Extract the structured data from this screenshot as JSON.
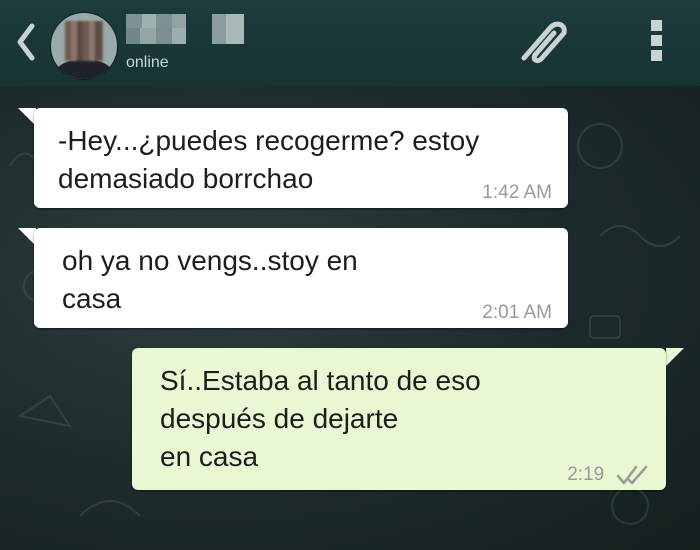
{
  "header": {
    "status": "online"
  },
  "messages": [
    {
      "direction": "incoming",
      "lines": [
        "-Hey...¿puedes recogerme? estoy",
        "demasiado borrchao"
      ],
      "time": "1:42 AM"
    },
    {
      "direction": "incoming",
      "lines": [
        "oh ya no vengs..stoy en",
        "casa"
      ],
      "time": "2:01 AM"
    },
    {
      "direction": "outgoing",
      "lines": [
        "Sí..Estaba al tanto de eso",
        "después de dejarte",
        "en casa"
      ],
      "time": "2:19",
      "receipt": "double-check-icon"
    }
  ],
  "icons": {
    "back": "chevron-left-icon",
    "attach": "paperclip-icon",
    "menu": "overflow-menu-icon"
  },
  "colors": {
    "header_bg": "#1e3c3d",
    "incoming_bubble": "#ffffff",
    "outgoing_bubble": "#eaf7d3",
    "timestamp": "#9a9a9a"
  }
}
